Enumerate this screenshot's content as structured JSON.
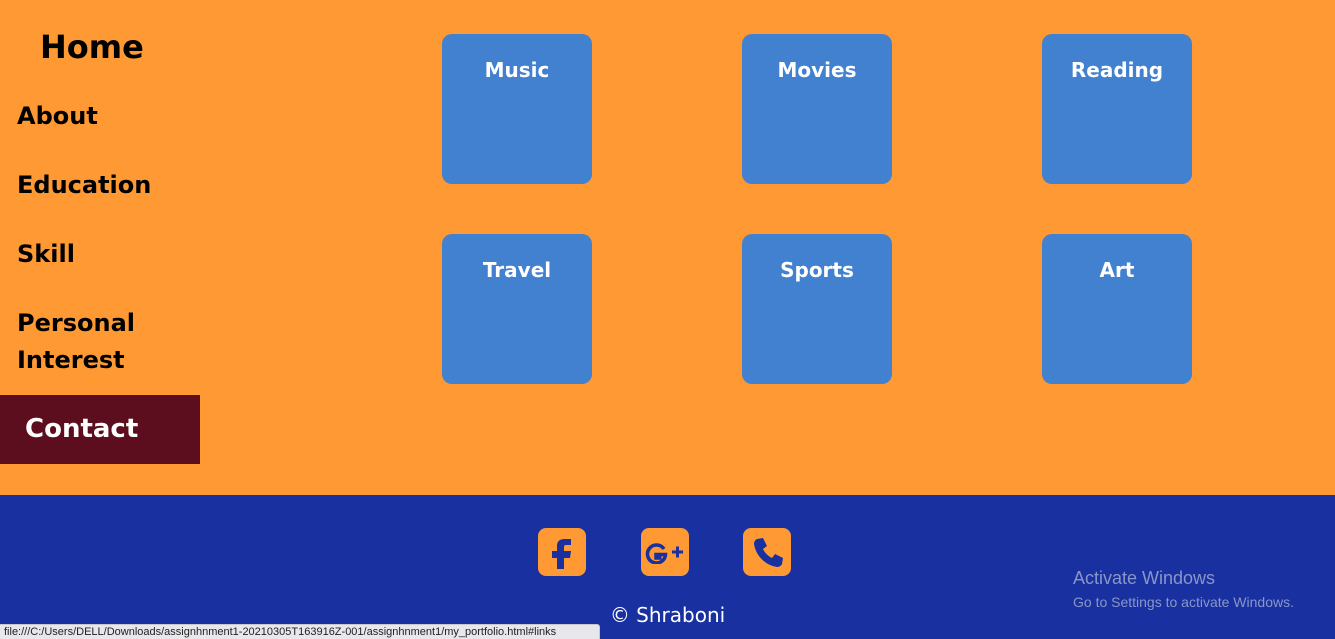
{
  "nav": {
    "home": "Home",
    "items": [
      "About",
      "Education",
      "Skill",
      "Personal",
      "Interest"
    ],
    "personal_interest": [
      "Personal",
      "Interest"
    ],
    "contact": "Contact"
  },
  "cards": [
    "Music",
    "Movies",
    "Reading",
    "Travel",
    "Sports",
    "Art"
  ],
  "footer": {
    "icons": [
      "facebook-icon",
      "google-plus-icon",
      "phone-icon"
    ],
    "copyright": "© Shraboni"
  },
  "watermark": {
    "title": "Activate Windows",
    "subtitle": "Go to Settings to activate Windows."
  },
  "status_url": "file:///C:/Users/DELL/Downloads/assignhnment1-20210305T163916Z-001/assignhnment1/my_portfolio.html#links",
  "colors": {
    "main_bg": "#ff9933",
    "card_bg": "#4280d0",
    "active_nav_bg": "#5c0e1e",
    "footer_bg": "#1830a0"
  }
}
